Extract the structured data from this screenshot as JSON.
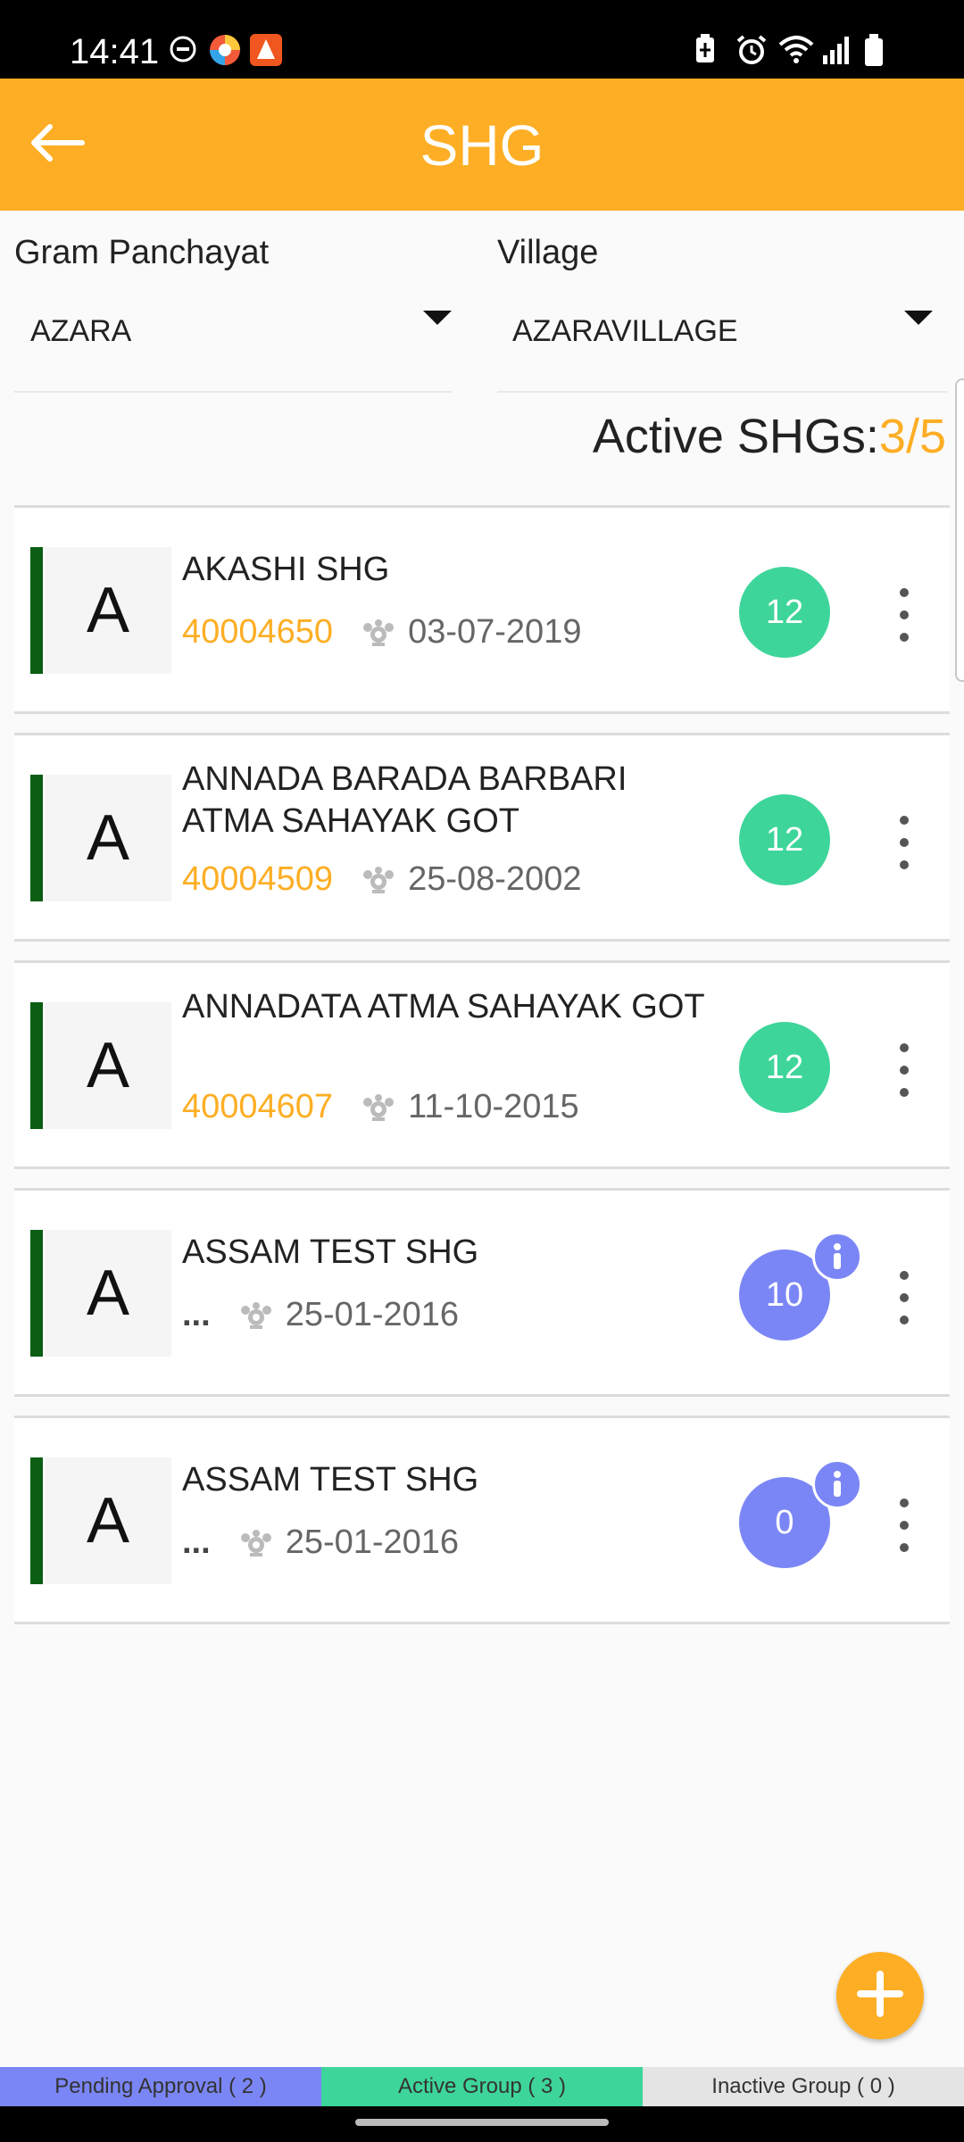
{
  "status_bar": {
    "time": "14:41",
    "left_icons": [
      "do-not-disturb-icon",
      "app-icon-colorful",
      "app-icon-orange"
    ],
    "right_icons": [
      "battery-saver-icon",
      "alarm-icon",
      "wifi-icon",
      "signal-icon",
      "battery-icon"
    ]
  },
  "app_bar": {
    "title": "SHG",
    "back_icon": "arrow-left-icon"
  },
  "filters": {
    "gram_panchayat": {
      "label": "Gram Panchayat",
      "value": "AZARA"
    },
    "village": {
      "label": "Village",
      "value": "AZARAVILLAGE"
    }
  },
  "summary": {
    "label": "Active SHGs:",
    "count": "3/5"
  },
  "groups": [
    {
      "initial": "A",
      "name": "AKASHI SHG",
      "code": "40004650",
      "date": "03-07-2019",
      "members": "12",
      "badge_color": "#3ed59a",
      "info": false
    },
    {
      "initial": "A",
      "name": "ANNADA BARADA BARBARI ATMA SAHAYAK GOT",
      "code": "40004509",
      "date": "25-08-2002",
      "members": "12",
      "badge_color": "#3ed59a",
      "info": false
    },
    {
      "initial": "A",
      "name": "ANNADATA ATMA SAHAYAK GOT",
      "code": "40004607",
      "date": "11-10-2015",
      "members": "12",
      "badge_color": "#3ed59a",
      "info": false
    },
    {
      "initial": "A",
      "name": "ASSAM TEST SHG",
      "code": "...",
      "date": "25-01-2016",
      "members": "10",
      "badge_color": "#7b86f6",
      "info": true
    },
    {
      "initial": "A",
      "name": "ASSAM TEST SHG",
      "code": "...",
      "date": "25-01-2016",
      "members": "0",
      "badge_color": "#7b86f6",
      "info": true
    }
  ],
  "tabs": {
    "pending": "Pending Approval ( 2 )",
    "active": "Active Group ( 3 )",
    "inactive": "Inactive Group ( 0 )"
  },
  "colors": {
    "accent": "#fdae24",
    "green": "#3ed59a",
    "purple": "#7b86f6",
    "status_bar": "#0b5e14"
  }
}
